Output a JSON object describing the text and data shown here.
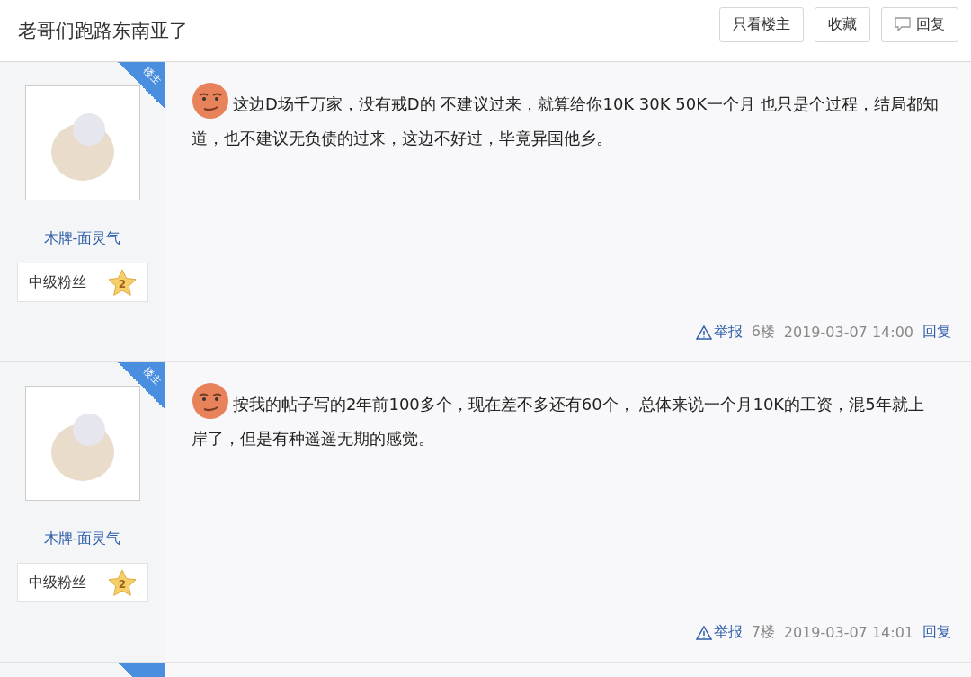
{
  "thread": {
    "title": "老哥们跑路东南亚了",
    "buttons": [
      {
        "label": "只看楼主",
        "icon": false
      },
      {
        "label": "收藏",
        "icon": false
      },
      {
        "label": "回复",
        "icon": true
      }
    ]
  },
  "posts": [
    {
      "op_badge": "楼主",
      "username": "木牌-面灵气",
      "rank": "中级粉丝",
      "level": "2",
      "text": "这边D场千万家，没有戒D的 不建议过来，就算给你10K 30K 50K一个月 也只是个过程，结局都知道，也不建议无负债的过来，这边不好过，毕竟异国他乡。",
      "report": "举报",
      "floor": "6楼",
      "time": "2019-03-07 14:00",
      "reply": "回复"
    },
    {
      "op_badge": "楼主",
      "username": "木牌-面灵气",
      "rank": "中级粉丝",
      "level": "2",
      "text": "按我的帖子写的2年前100多个，现在差不多还有60个， 总体来说一个月10K的工资，混5年就上岸了，但是有种遥遥无期的感觉。",
      "report": "举报",
      "floor": "7楼",
      "time": "2019-03-07 14:01",
      "reply": "回复"
    }
  ],
  "next_post": {
    "op": true
  }
}
